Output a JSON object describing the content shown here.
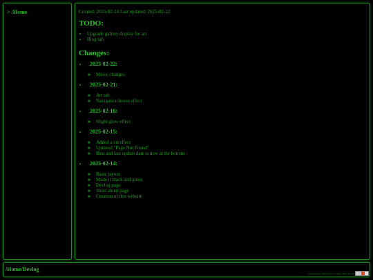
{
  "sidebar": {
    "nav_home": "> /Home"
  },
  "main": {
    "meta": "Created: 2025-02-14 Last updated: 2025-02-22",
    "todo_heading": "TODO:",
    "todo_items": [
      "Upgrade gallery display for art",
      "Blog tab"
    ],
    "changes_heading": "Changes:",
    "versions": [
      {
        "date": "2025-02-22:",
        "items": [
          "Minor changes"
        ]
      },
      {
        "date": "2025-02-21:",
        "items": [
          "Art tab",
          "Navigation hover effect"
        ]
      },
      {
        "date": "2025-02-16:",
        "items": [
          "Slight glow effect"
        ]
      },
      {
        "date": "2025-02-15:",
        "items": [
          "Added a crt effect",
          "Updated \"Page Not Found\"",
          "Best and last update date is now at the bottom"
        ]
      },
      {
        "date": "2025-02-14:",
        "items": [
          "Basic layout",
          "Made it black and green",
          "Devlog page",
          "Short about page",
          "Creation of this website"
        ]
      }
    ]
  },
  "footer": {
    "path": "/Home/Devlog",
    "badge_text": "Last updated: 2025-02-22 Created: 2025-02-14"
  },
  "colors": {
    "background": "#000000",
    "accent_green": "#26c026",
    "border_green": "#1f8f1f"
  }
}
